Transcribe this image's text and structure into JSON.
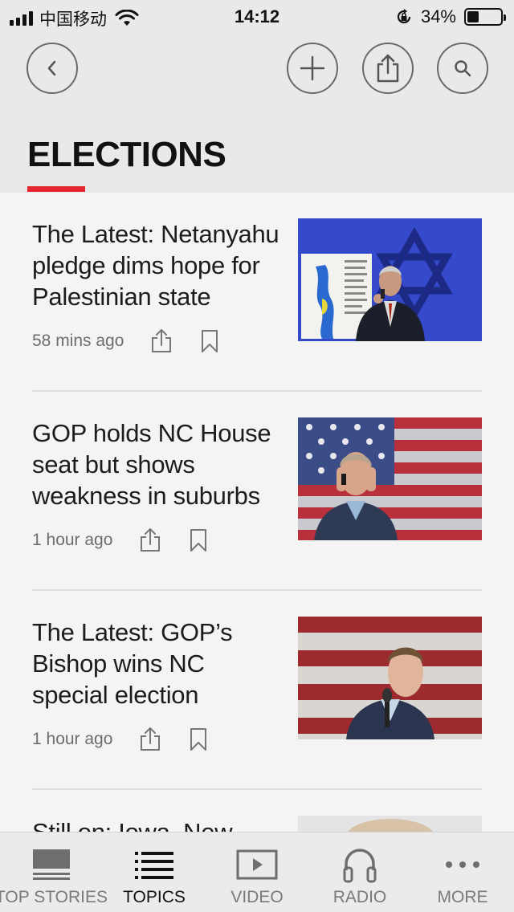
{
  "status_bar": {
    "carrier": "中国移动",
    "time": "14:12",
    "battery_pct": "34%",
    "battery_level": 0.34
  },
  "header": {
    "section_title": "ELECTIONS",
    "accent_color": "#e8262d"
  },
  "articles": [
    {
      "headline": "The Latest: Netanyahu pledge dims hope for Palestinian state",
      "time": "58 mins ago"
    },
    {
      "headline": "GOP holds NC House seat but shows weakness in suburbs",
      "time": "1 hour ago"
    },
    {
      "headline": "The Latest: GOP’s Bishop wins NC special election",
      "time": "1 hour ago"
    },
    {
      "headline": "Still on: Iowa, New",
      "time": ""
    }
  ],
  "tabs": [
    {
      "label": "TOP STORIES",
      "icon": "top-stories-icon"
    },
    {
      "label": "TOPICS",
      "icon": "topics-icon",
      "active": true
    },
    {
      "label": "VIDEO",
      "icon": "video-icon"
    },
    {
      "label": "RADIO",
      "icon": "headphones-icon"
    },
    {
      "label": "MORE",
      "icon": "more-icon"
    }
  ]
}
